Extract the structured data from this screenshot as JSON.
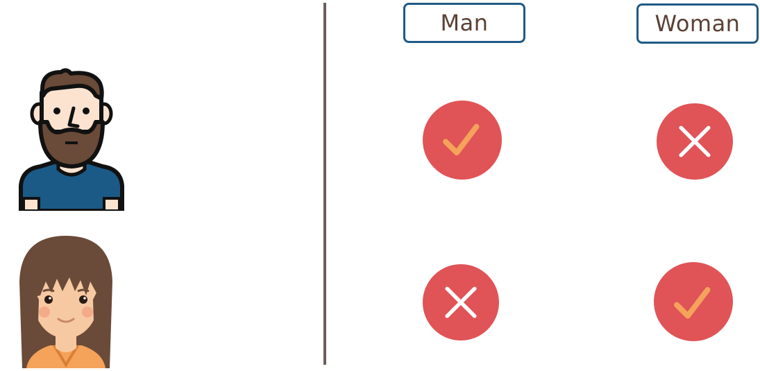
{
  "headers": {
    "man": "Man",
    "woman": "Woman"
  },
  "rows": [
    {
      "avatar": "man-avatar-icon",
      "man": "check",
      "woman": "cross"
    },
    {
      "avatar": "woman-avatar-icon",
      "man": "cross",
      "woman": "check"
    }
  ],
  "colors": {
    "circle": "#e05357",
    "check": "#f5a25a",
    "cross": "#ffffff",
    "header_border": "#1f5a85",
    "header_text": "#5a4034",
    "divider": "#6b5e58"
  }
}
